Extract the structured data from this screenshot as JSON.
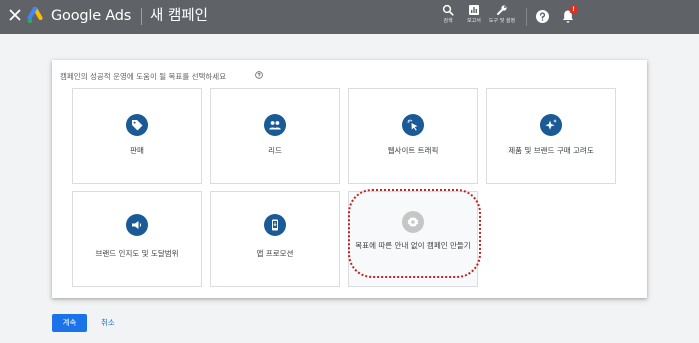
{
  "header": {
    "app_name": "Google Ads",
    "page_title": "새 캠페인",
    "tools": [
      {
        "label": "검색",
        "icon": "search-icon"
      },
      {
        "label": "보고서",
        "icon": "reports-icon"
      },
      {
        "label": "도구 및 설정",
        "icon": "wrench-icon"
      }
    ],
    "notification_badge": "!"
  },
  "main": {
    "question": "캠페인의 성공적 운영에 도움이 될 목표를 선택하세요",
    "goals": [
      {
        "label": "판매",
        "icon": "tag-icon"
      },
      {
        "label": "리드",
        "icon": "people-icon"
      },
      {
        "label": "웹사이트 트래픽",
        "icon": "cursor-click-icon"
      },
      {
        "label": "제품 및 브랜드 구매 고려도",
        "icon": "sparkle-icon"
      },
      {
        "label": "브랜드 인지도 및 도달범위",
        "icon": "megaphone-icon"
      },
      {
        "label": "앱 프로모션",
        "icon": "phone-icon"
      },
      {
        "label": "목표에 따른 안내 없이 캠페인 만들기",
        "icon": "gear-icon"
      }
    ]
  },
  "footer": {
    "continue_label": "계속",
    "cancel_label": "취소"
  },
  "colors": {
    "topbar": "#5f6368",
    "accent": "#1a73e8",
    "goal_icon": "#1a5a96",
    "highlight": "#c5221f"
  }
}
